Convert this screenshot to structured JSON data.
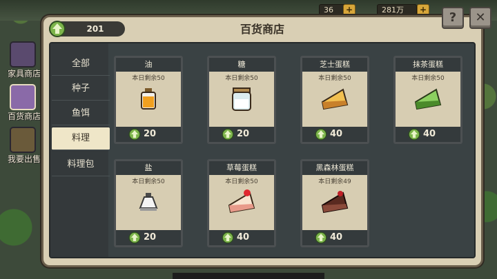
{
  "hud": {
    "currency_a": "36",
    "currency_b": "281万"
  },
  "top_buttons": {
    "help_glyph": "?",
    "close_glyph": "✕"
  },
  "side_tabs": [
    {
      "label": "家具商店",
      "icon": "wardrobe-icon"
    },
    {
      "label": "百货商店",
      "icon": "chest-icon"
    },
    {
      "label": "我要出售",
      "icon": "sell-quill-icon"
    }
  ],
  "dialog": {
    "title": "百货商店",
    "coins": "201"
  },
  "categories": [
    "全部",
    "种子",
    "鱼饵",
    "料理",
    "料理包"
  ],
  "active_category": "料理",
  "items": [
    {
      "name": "油",
      "stock": "本日剩余50",
      "price": "20",
      "icon": "oil-bottle-icon"
    },
    {
      "name": "糖",
      "stock": "本日剩余50",
      "price": "20",
      "icon": "sugar-jar-icon"
    },
    {
      "name": "芝士蛋糕",
      "stock": "本日剩余50",
      "price": "40",
      "icon": "cheesecake-icon"
    },
    {
      "name": "抹茶蛋糕",
      "stock": "本日剩余50",
      "price": "40",
      "icon": "matcha-cake-icon"
    },
    {
      "name": "盐",
      "stock": "本日剩余50",
      "price": "20",
      "icon": "salt-shaker-icon"
    },
    {
      "name": "草莓蛋糕",
      "stock": "本日剩余50",
      "price": "40",
      "icon": "strawberry-cake-icon"
    },
    {
      "name": "黑森林蛋糕",
      "stock": "本日剩余49",
      "price": "40",
      "icon": "black-forest-cake-icon"
    }
  ],
  "colors": {
    "panel": "#d9cfb4",
    "dark": "#343a3c",
    "coin_green": "#5c9a3a"
  }
}
